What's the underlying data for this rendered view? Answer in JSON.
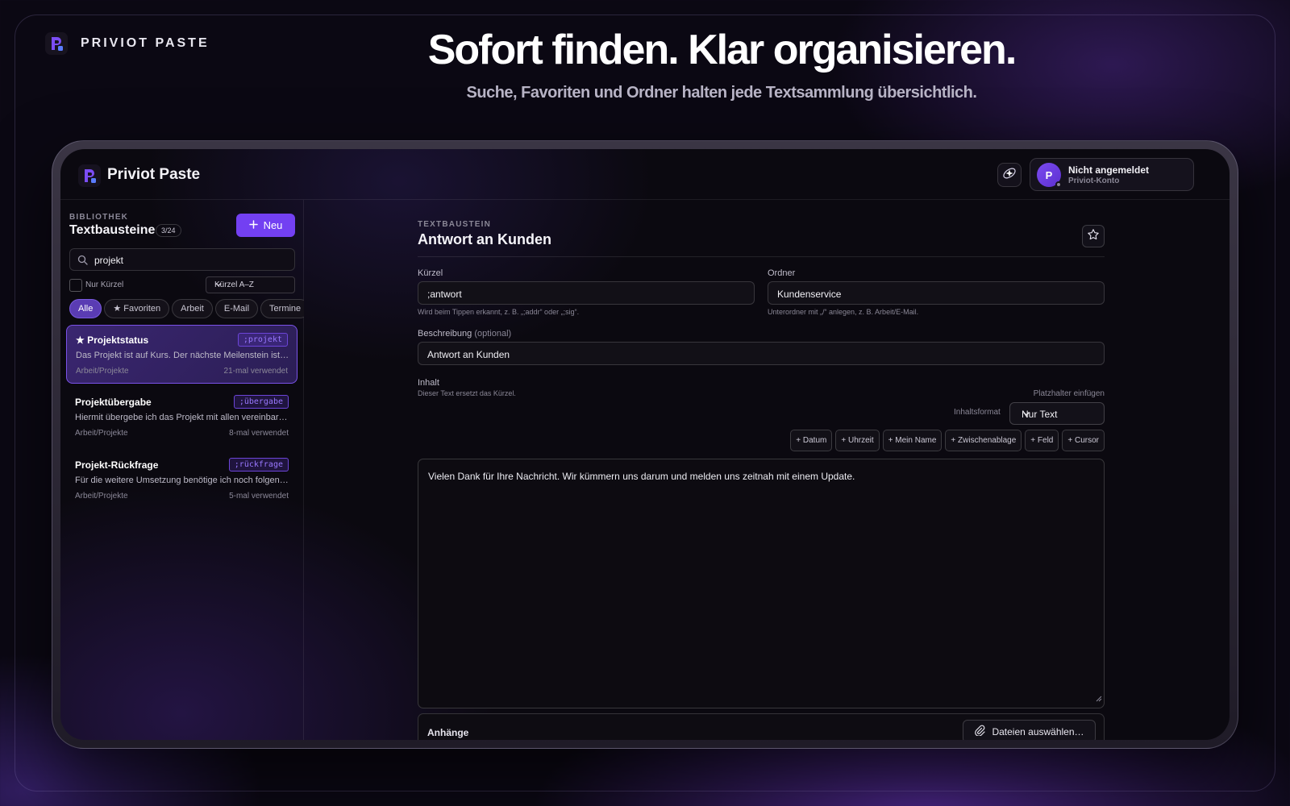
{
  "promo": {
    "brand": "PRIVIOT PASTE",
    "headline": "Sofort finden. Klar organisieren.",
    "subline": "Suche, Favoriten und Ordner halten jede Textsammlung übersichtlich."
  },
  "app": {
    "title": "Priviot Paste",
    "account_name": "Nicht angemeldet",
    "account_sub": "Priviot-Konto",
    "avatar_letter": "P"
  },
  "sidebar": {
    "eyebrow": "BIBLIOTHEK",
    "title": "Textbausteine",
    "count": "3/24",
    "new_label": "Neu",
    "search_value": "projekt",
    "only_shortcut_label": "Nur Kürzel",
    "sort_value": "Kürzel A–Z",
    "chips": [
      "Alle",
      "★ Favoriten",
      "Arbeit",
      "E-Mail",
      "Termine"
    ],
    "items": [
      {
        "title": "★ Projektstatus",
        "key": ";projekt",
        "preview": "Das Projekt ist auf Kurs. Der nächste Meilenstein ist f…",
        "folder": "Arbeit/Projekte",
        "usage": "21-mal verwendet"
      },
      {
        "title": "Projektübergabe",
        "key": ";übergabe",
        "preview": "Hiermit übergebe ich das Projekt mit allen vereinbart…",
        "folder": "Arbeit/Projekte",
        "usage": "8-mal verwendet"
      },
      {
        "title": "Projekt-Rückfrage",
        "key": ";rückfrage",
        "preview": "Für die weitere Umsetzung benötige ich noch folgend…",
        "folder": "Arbeit/Projekte",
        "usage": "5-mal verwendet"
      }
    ]
  },
  "editor": {
    "eyebrow": "TEXTBAUSTEIN",
    "title": "Antwort an Kunden",
    "shortcut_label": "Kürzel",
    "shortcut_value": ";antwort",
    "shortcut_hint": "Wird beim Tippen erkannt, z. B. „;addr“ oder „;sig“.",
    "folder_label": "Ordner",
    "folder_value": "Kundenservice",
    "folder_hint": "Unterordner mit „/“ anlegen, z. B. Arbeit/E-Mail.",
    "description_label": "Beschreibung",
    "description_optional": "(optional)",
    "description_value": "Antwort an Kunden",
    "content_label": "Inhalt",
    "content_hint": "Dieser Text ersetzt das Kürzel.",
    "placeholder_label": "Platzhalter einfügen",
    "format_label": "Inhaltsformat",
    "format_value": "Nur Text",
    "placeholders": [
      "+ Datum",
      "+ Uhrzeit",
      "+ Mein Name",
      "+ Zwischenablage",
      "+ Feld",
      "+ Cursor"
    ],
    "content_text": "Vielen Dank für Ihre Nachricht. Wir kümmern uns darum und melden uns zeitnah mit einem Update.",
    "attachments_label": "Anhänge",
    "attach_button": "Dateien auswählen…"
  },
  "colors": {
    "accent": "#7340f2",
    "key_text": "#9a78ff"
  }
}
